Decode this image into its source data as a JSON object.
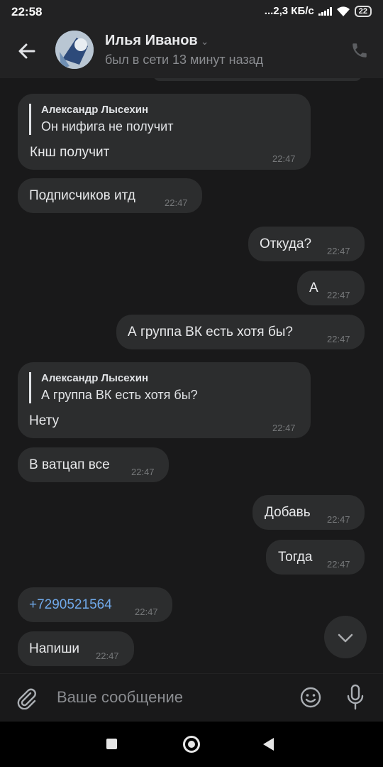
{
  "status_bar": {
    "time": "22:58",
    "network": "...2,3 КБ/с",
    "battery": "22"
  },
  "header": {
    "name": "Илья Иванов",
    "last_seen": "был в сети 13 минут назад"
  },
  "messages": [
    {
      "reply_author": "Александр Лысехин",
      "reply_text": "Он нифига не получит",
      "text": "Кнш получит",
      "time": "22:47"
    },
    {
      "text": "Подписчиков итд",
      "time": "22:47"
    },
    {
      "text": "Откуда?",
      "time": "22:47"
    },
    {
      "text": "А",
      "time": "22:47"
    },
    {
      "text": "А группа ВК есть хотя бы?",
      "time": "22:47"
    },
    {
      "reply_author": "Александр Лысехин",
      "reply_text": "А группа ВК есть хотя бы?",
      "text": "Нету",
      "time": "22:47"
    },
    {
      "text": "В ватцап все",
      "time": "22:47"
    },
    {
      "text": "Добавь",
      "time": "22:47"
    },
    {
      "text": "Тогда",
      "time": "22:47"
    },
    {
      "text": "+7290521564",
      "time": "22:47"
    },
    {
      "text": "Напиши",
      "time": "22:47"
    }
  ],
  "composer": {
    "placeholder": "Ваше сообщение"
  },
  "colors": {
    "background": "#19191a",
    "bubble": "#2c2d2e",
    "header": "#222223",
    "link": "#71aaeb",
    "time": "#76787a"
  },
  "icons": [
    "back-arrow-icon",
    "chevron-down-icon",
    "phone-icon",
    "attach-icon",
    "emoji-icon",
    "microphone-icon",
    "scroll-down-icon"
  ]
}
